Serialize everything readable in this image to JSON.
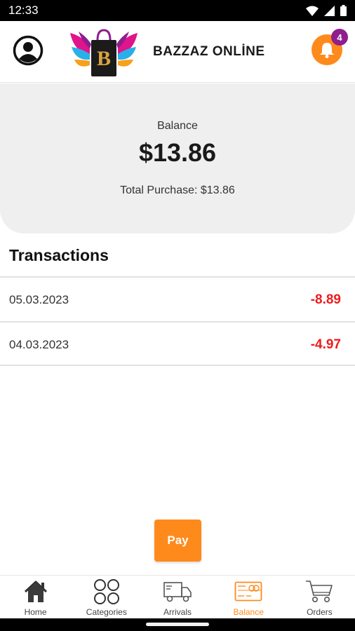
{
  "status_bar": {
    "time": "12:33"
  },
  "header": {
    "brand": "BAZZAZ ONLİNE",
    "notification_count": "4",
    "colors": {
      "accent": "#ff8a1c",
      "badge": "#8e1e8e"
    }
  },
  "balance": {
    "label": "Balance",
    "amount": "$13.86",
    "total_purchase": "Total Purchase: $13.86"
  },
  "transactions": {
    "title": "Transactions",
    "items": [
      {
        "date": "05.03.2023",
        "amount": "-8.89"
      },
      {
        "date": "04.03.2023",
        "amount": "-4.97"
      }
    ],
    "amount_color": "#ee1c1c"
  },
  "pay_button": {
    "label": "Pay"
  },
  "bottom_nav": {
    "items": [
      {
        "label": "Home",
        "icon": "home-icon"
      },
      {
        "label": "Categories",
        "icon": "categories-icon"
      },
      {
        "label": "Arrivals",
        "icon": "truck-icon"
      },
      {
        "label": "Balance",
        "icon": "card-icon",
        "active": true
      },
      {
        "label": "Orders",
        "icon": "cart-icon"
      }
    ]
  }
}
